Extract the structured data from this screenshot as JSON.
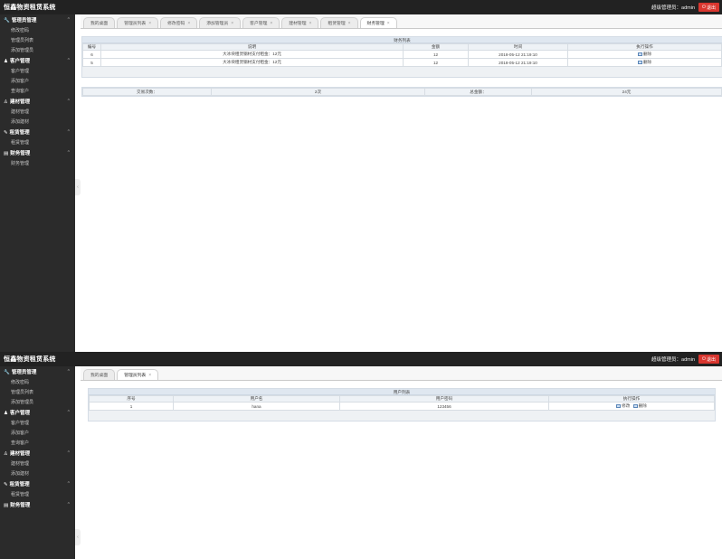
{
  "screens": [
    {
      "app_title": "恒鑫物资租赁系统",
      "user_label": "超级管理员：admin",
      "logout_label": "退出",
      "sidebar": [
        {
          "title": "管理员管理",
          "icon": "wrench-icon",
          "items": [
            "修改密码",
            "管理员列表",
            "添加管理员"
          ]
        },
        {
          "title": "客户管理",
          "icon": "user-icon",
          "items": [
            "客户管理",
            "添加客户",
            "查询客户"
          ]
        },
        {
          "title": "建材管理",
          "icon": "person-icon",
          "items": [
            "建材管理",
            "添加建材"
          ]
        },
        {
          "title": "租赁管理",
          "icon": "edit-icon",
          "items": [
            "租赁管理"
          ]
        },
        {
          "title": "财务管理",
          "icon": "card-icon",
          "items": [
            "财务管理"
          ]
        }
      ],
      "tabs": [
        {
          "label": "我的桌面",
          "closable": false
        },
        {
          "label": "管理员列表",
          "closable": true
        },
        {
          "label": "修改密码",
          "closable": true
        },
        {
          "label": "添加管理员",
          "closable": true
        },
        {
          "label": "客户管理",
          "closable": true
        },
        {
          "label": "建材管理",
          "closable": true
        },
        {
          "label": "租赁管理",
          "closable": true
        },
        {
          "label": "财务管理",
          "closable": true,
          "active": true
        }
      ],
      "table": {
        "title": "财务列表",
        "columns": [
          "编号",
          "说明",
          "金额",
          "时间",
          "执行操作"
        ],
        "rows": [
          [
            "6",
            "大冰块租赁钢材支付租金：12元",
            "12",
            "2018-05-12 21:19:10"
          ],
          [
            "5",
            "大冰块租赁钢材支付租金：12元",
            "12",
            "2018-05-12 21:19:10"
          ]
        ],
        "ops": [
          "删除"
        ]
      },
      "summary": {
        "count_label": "交易次数：",
        "count_value": "2次",
        "total_label": "总金额：",
        "total_value": "24元"
      }
    },
    {
      "app_title": "恒鑫物资租赁系统",
      "user_label": "超级管理员：admin",
      "logout_label": "退出",
      "sidebar": [
        {
          "title": "管理员管理",
          "icon": "wrench-icon",
          "items": [
            "修改密码",
            "管理员列表",
            "添加管理员"
          ]
        },
        {
          "title": "客户管理",
          "icon": "user-icon",
          "items": [
            "客户管理",
            "添加客户",
            "查询客户"
          ]
        },
        {
          "title": "建材管理",
          "icon": "person-icon",
          "items": [
            "建材管理",
            "添加建材"
          ]
        },
        {
          "title": "租赁管理",
          "icon": "edit-icon",
          "items": [
            "租赁管理"
          ]
        },
        {
          "title": "财务管理",
          "icon": "card-icon",
          "items": []
        }
      ],
      "tabs": [
        {
          "label": "我的桌面",
          "closable": false
        },
        {
          "label": "管理员列表",
          "closable": true,
          "active": true
        }
      ],
      "table": {
        "title": "用户列表",
        "columns": [
          "序号",
          "用户名",
          "用户密码",
          "执行操作"
        ],
        "rows": [
          [
            "1",
            "hana",
            "123456"
          ]
        ],
        "ops": [
          "修改",
          "删除"
        ]
      }
    }
  ],
  "colors": {
    "topbar": "#222222",
    "sidebar": "#2b2b2b",
    "logout": "#d9362f",
    "panel_head": "#dfe7f0"
  }
}
